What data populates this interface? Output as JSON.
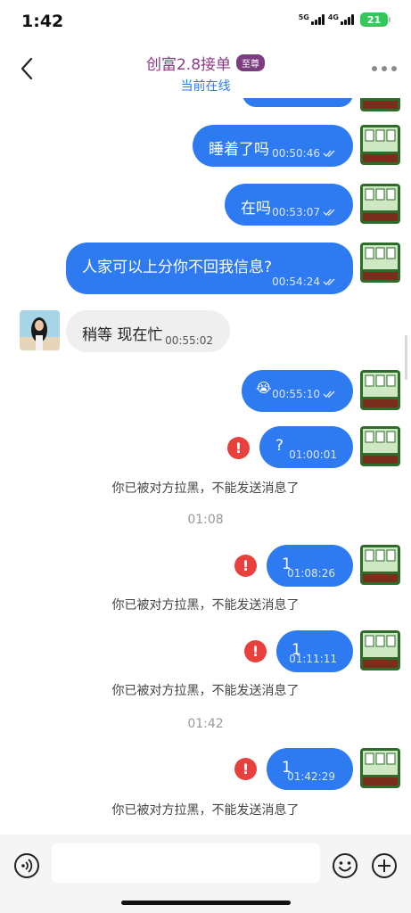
{
  "status_bar": {
    "time": "1:42",
    "net1": "5G",
    "net2": "4G",
    "battery": "21"
  },
  "header": {
    "title": "创富2.8接单",
    "badge": "至尊",
    "subtitle": "当前在线"
  },
  "messages": [
    {
      "text": "睡着了吗",
      "time": "00:50:46"
    },
    {
      "text": "在吗",
      "time": "00:53:07"
    },
    {
      "text": "人家可以上分你不回我信息?",
      "time": "00:54:24"
    },
    {
      "text": "稍等 现在忙",
      "time": "00:55:02"
    },
    {
      "text": "😭",
      "time": "00:55:10"
    },
    {
      "text": "?",
      "time": "01:00:01"
    },
    {
      "text": "1",
      "time": "01:08:26"
    },
    {
      "text": "1",
      "time": "01:11:11"
    },
    {
      "text": "1",
      "time": "01:42:29"
    }
  ],
  "system_notice": "你已被对方拉黑，不能发送消息了",
  "error_mark": "!",
  "timestamps": [
    "01:08",
    "01:42"
  ],
  "icons": {
    "back": "back-arrow-icon",
    "more": "more-dots-icon",
    "read": "double-check-icon",
    "voice": "voice-icon",
    "emoji": "emoji-icon",
    "plus": "plus-icon"
  },
  "colors": {
    "accent": "#2d7af1",
    "error": "#e8403d",
    "title": "#8e3a86"
  },
  "composer": {
    "placeholder": ""
  }
}
